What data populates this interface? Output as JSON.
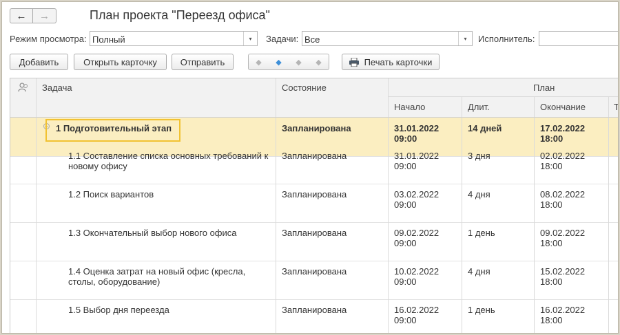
{
  "window": {
    "title": "План проекта \"Переезд офиса\""
  },
  "nav": {
    "back_glyph": "←",
    "forward_glyph": "→"
  },
  "filters": {
    "view_mode_label": "Режим просмотра:",
    "view_mode_value": "Полный",
    "tasks_label": "Задачи:",
    "tasks_value": "Все",
    "assignee_label": "Исполнитель:",
    "assignee_value": ""
  },
  "toolbar": {
    "add": "Добавить",
    "open_card": "Открыть карточку",
    "send": "Отправить",
    "print_card": "Печать карточки"
  },
  "table": {
    "headers": {
      "task": "Задача",
      "state": "Состояние",
      "plan": "План",
      "start": "Начало",
      "duration": "Длит.",
      "end": "Окончание",
      "next": "Тр"
    },
    "rows": [
      {
        "name": "1  Подготовительный этап",
        "state": "Запланирована",
        "start1": "31.01.2022",
        "start2": "09:00",
        "dur": "14 дней",
        "end1": "17.02.2022",
        "end2": "18:00"
      },
      {
        "name": "1.1  Составление списка основных требований к новому офису",
        "state": "Запланирована",
        "start1": "31.01.2022",
        "start2": "09:00",
        "dur": "3 дня",
        "end1": "02.02.2022",
        "end2": "18:00"
      },
      {
        "name": "1.2  Поиск вариантов",
        "state": "Запланирована",
        "start1": "03.02.2022",
        "start2": "09:00",
        "dur": "4 дня",
        "end1": "08.02.2022",
        "end2": "18:00"
      },
      {
        "name": "1.3  Окончательный выбор нового офиса",
        "state": "Запланирована",
        "start1": "09.02.2022",
        "start2": "09:00",
        "dur": "1 день",
        "end1": "09.02.2022",
        "end2": "18:00"
      },
      {
        "name": "1.4  Оценка затрат на новый офис (кресла, столы, оборудование)",
        "state": "Запланирована",
        "start1": "10.02.2022",
        "start2": "09:00",
        "dur": "4 дня",
        "end1": "15.02.2022",
        "end2": "18:00"
      },
      {
        "name": "1.5  Выбор дня переезда",
        "state": "Запланирована",
        "start1": "16.02.2022",
        "start2": "09:00",
        "dur": "1 день",
        "end1": "16.02.2022",
        "end2": "18:00"
      }
    ]
  },
  "colors": {
    "selected_row": "#fbeec1",
    "focus_border": "#f1c232",
    "accent_arrow": "#3d8fd8"
  }
}
